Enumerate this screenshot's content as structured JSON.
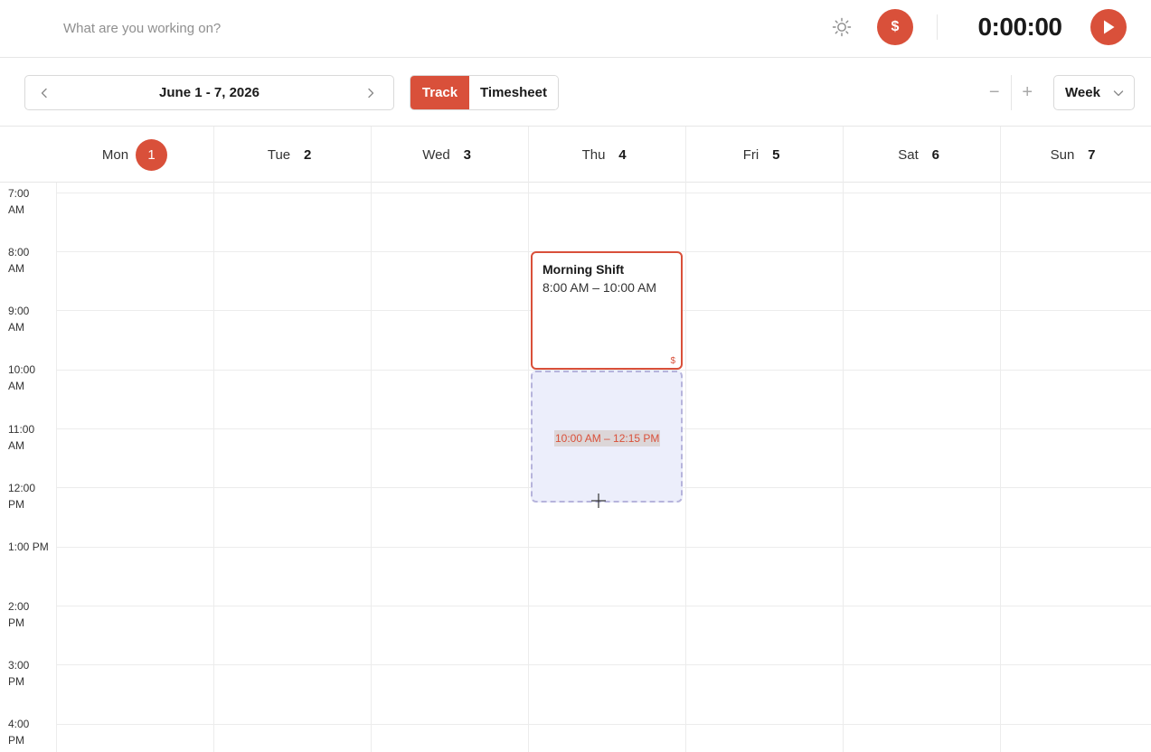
{
  "topbar": {
    "work_placeholder": "What are you working on?",
    "billable_symbol": "$",
    "timer": "0:00:00",
    "icons": {
      "theme": "sun-icon",
      "play": "play-icon"
    }
  },
  "toolbar": {
    "date_range": "June 1 - 7, 2026",
    "modes": {
      "track": "Track",
      "timesheet": "Timesheet",
      "active": "track"
    },
    "zoom_out": "−",
    "zoom_in": "+",
    "view": "Week"
  },
  "days": [
    {
      "name": "Mon",
      "num": "1",
      "today": true
    },
    {
      "name": "Tue",
      "num": "2"
    },
    {
      "name": "Wed",
      "num": "3"
    },
    {
      "name": "Thu",
      "num": "4"
    },
    {
      "name": "Fri",
      "num": "5"
    },
    {
      "name": "Sat",
      "num": "6"
    },
    {
      "name": "Sun",
      "num": "7"
    }
  ],
  "hours": [
    {
      "line1": "7:00",
      "line2": "AM"
    },
    {
      "line1": "8:00",
      "line2": "AM"
    },
    {
      "line1": "9:00",
      "line2": "AM"
    },
    {
      "line1": "10:00",
      "line2": "AM"
    },
    {
      "line1": "11:00",
      "line2": "AM"
    },
    {
      "line1": "12:00",
      "line2": "PM"
    },
    {
      "line1": "1:00 PM",
      "line2": ""
    },
    {
      "line1": "2:00",
      "line2": "PM"
    },
    {
      "line1": "3:00",
      "line2": "PM"
    },
    {
      "line1": "4:00",
      "line2": "PM"
    }
  ],
  "event": {
    "title": "Morning Shift",
    "time": "8:00 AM – 10:00 AM",
    "billable_mark": "$",
    "accent": "#d9503a"
  },
  "selection": {
    "label": "10:00 AM – 12:15 PM"
  },
  "colors": {
    "accent": "#d9503a",
    "selection_fill": "#eceefb",
    "selection_border": "#b6b4dc"
  }
}
